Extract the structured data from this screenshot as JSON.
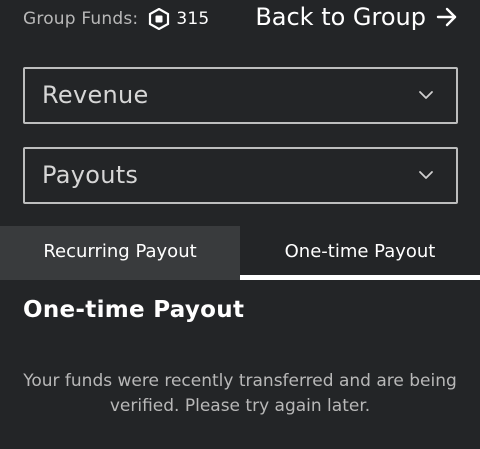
{
  "header": {
    "funds_label": "Group Funds:",
    "funds_amount": "315",
    "back_label": "Back to Group"
  },
  "dropdowns": [
    {
      "label": "Revenue"
    },
    {
      "label": "Payouts"
    }
  ],
  "tabs": [
    {
      "label": "Recurring Payout",
      "active": false
    },
    {
      "label": "One-time Payout",
      "active": true
    }
  ],
  "section": {
    "title": "One-time Payout",
    "message": "Your funds were recently transferred and are being verified. Please try again later."
  },
  "colors": {
    "background": "#232527",
    "tab_bar": "#393b3d",
    "muted_text": "#b8b8b8",
    "border": "#bdbebe"
  },
  "icons": {
    "currency": "robux-icon",
    "back": "arrow-right-icon",
    "dropdown": "chevron-down-icon"
  }
}
